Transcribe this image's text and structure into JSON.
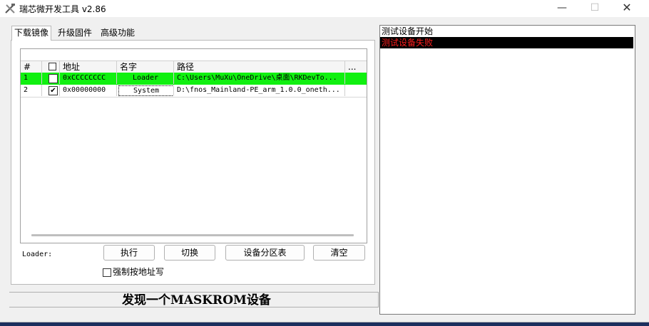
{
  "window": {
    "title": "瑞芯微开发工具 v2.86",
    "min_glyph": "—",
    "max_glyph": "☐",
    "close_glyph": "✕",
    "icon": "tools-icon"
  },
  "tabs": [
    "下载镜像",
    "升级固件",
    "高级功能"
  ],
  "grid": {
    "columns": [
      "#",
      "☐",
      "地址",
      "名字",
      "路径",
      "..."
    ],
    "rows": [
      {
        "index": "1",
        "checked": false,
        "address": "0xCCCCCCCC",
        "name": "Loader",
        "path": "C:\\Users\\MuXu\\OneDrive\\桌面\\RKDevTo...",
        "highlight": true
      },
      {
        "index": "2",
        "checked": true,
        "address": "0x00000000",
        "name": "System",
        "path": "D:\\fnos_Mainland-PE_arm_1.0.0_oneth...",
        "highlight": false
      }
    ]
  },
  "loader_label": "Loader:",
  "buttons": {
    "execute": "执行",
    "switch": "切换",
    "partition_table": "设备分区表",
    "clear": "清空"
  },
  "force_write_label": "强制按地址写",
  "status_text": "发现一个MASKROM设备",
  "log": [
    "测试设备开始",
    "测试设备失败"
  ],
  "colors": {
    "highlight_row": "#10f010",
    "log_error_text": "#ff1e1e",
    "log_error_bg": "#000000"
  }
}
